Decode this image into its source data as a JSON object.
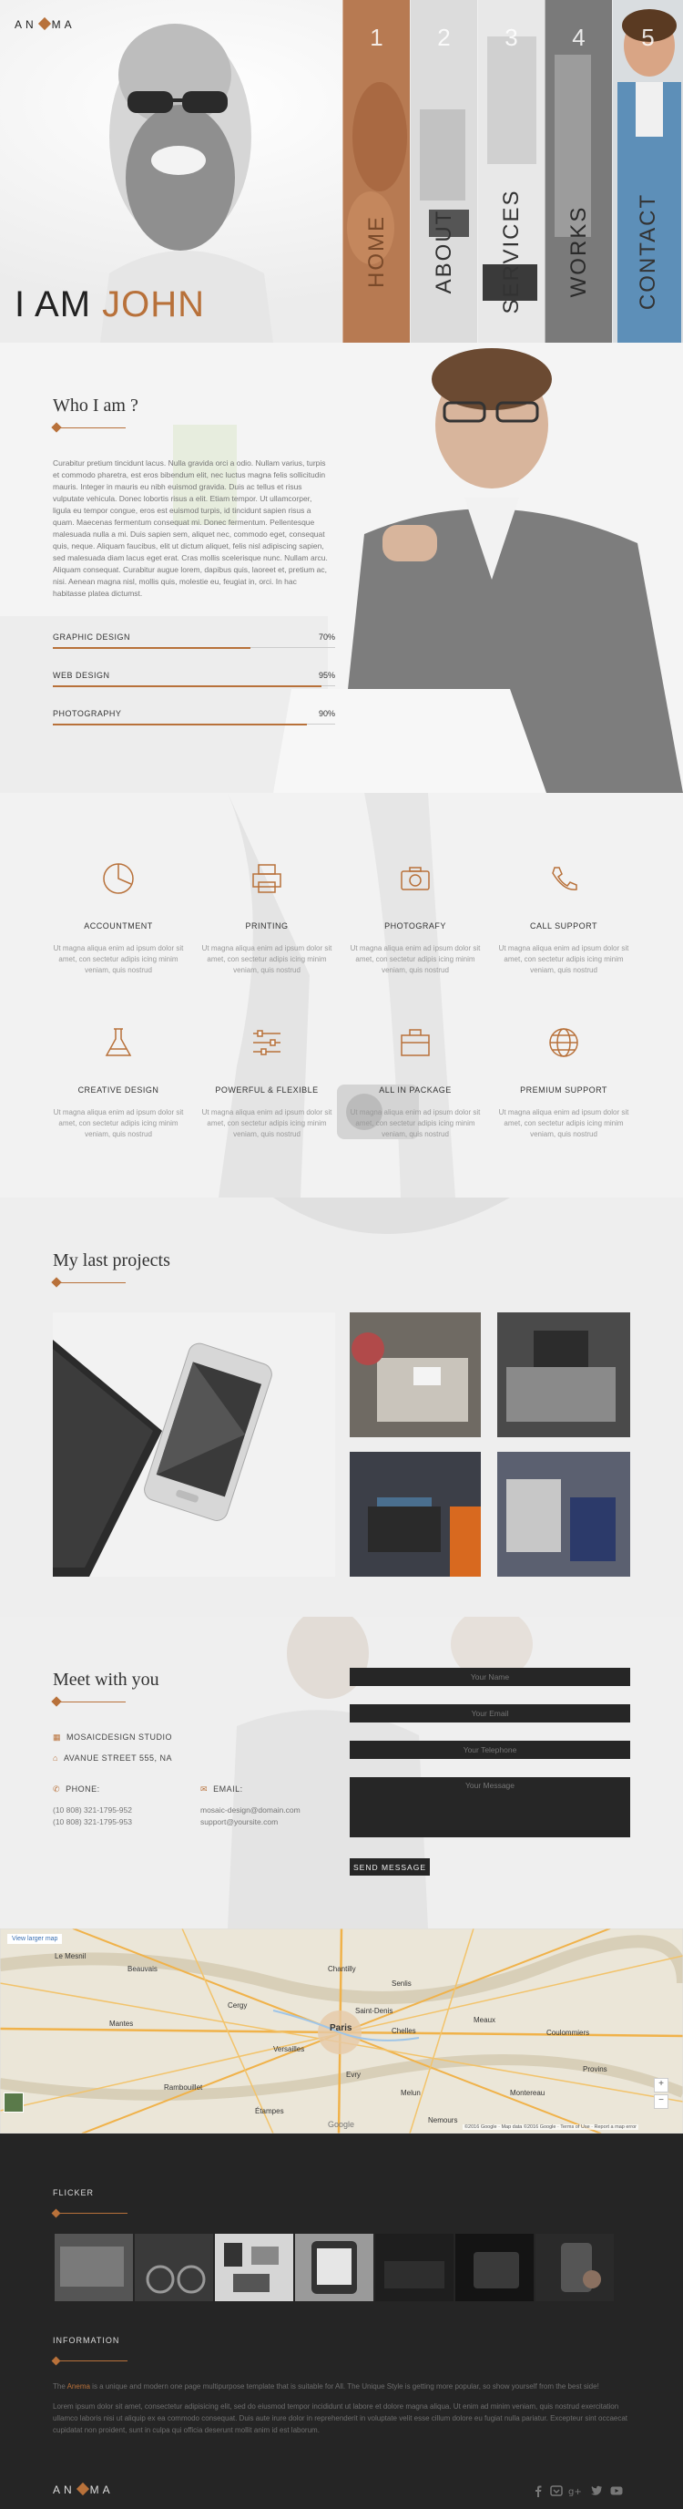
{
  "brand": {
    "logo_text_left": "AN",
    "logo_text_right": "MA",
    "accent": "#b8713a"
  },
  "hero": {
    "title_prefix": "I AM",
    "title_name": "JOHN",
    "panels": [
      {
        "num": "1",
        "label": "HOME"
      },
      {
        "num": "2",
        "label": "ABOUT"
      },
      {
        "num": "3",
        "label": "SERVICES"
      },
      {
        "num": "4",
        "label": "WORKS"
      },
      {
        "num": "5",
        "label": "CONTACT"
      }
    ]
  },
  "about": {
    "title": "Who I am ?",
    "text": "Curabitur pretium tincidunt lacus. Nulla gravida orci a odio. Nullam varius, turpis et commodo pharetra, est eros bibendum elit, nec luctus magna felis sollicitudin mauris. Integer in mauris eu nibh euismod gravida. Duis ac tellus et risus vulputate vehicula. Donec lobortis risus a elit. Etiam tempor. Ut ullamcorper, ligula eu tempor congue, eros est euismod turpis, id tincidunt sapien risus a quam. Maecenas fermentum consequat mi. Donec fermentum. Pellentesque malesuada nulla a mi. Duis sapien sem, aliquet nec, commodo eget, consequat quis, neque. Aliquam faucibus, elit ut dictum aliquet, felis nisl adipiscing sapien, sed malesuada diam lacus eget erat. Cras mollis scelerisque nunc. Nullam arcu. Aliquam consequat. Curabitur augue lorem, dapibus quis, laoreet et, pretium ac, nisi. Aenean magna nisl, mollis quis, molestie eu, feugiat in, orci. In hac habitasse platea dictumst.",
    "skills": [
      {
        "name": "GRAPHIC DESIGN",
        "pct_label": "70%",
        "value": 0.7
      },
      {
        "name": "WEB DESIGN",
        "pct_label": "95%",
        "value": 0.95
      },
      {
        "name": "PHOTOGRAPHY",
        "pct_label": "90%",
        "value": 0.9
      }
    ]
  },
  "services": {
    "items": [
      {
        "icon": "pie-chart-icon",
        "title": "ACCOUNTMENT",
        "desc": "Ut magna aliqua enim ad ipsum dolor sit amet, con sectetur adipis icing minim veniam, quis nostrud"
      },
      {
        "icon": "printer-icon",
        "title": "PRINTING",
        "desc": "Ut magna aliqua enim ad ipsum dolor sit amet, con sectetur adipis icing minim veniam, quis nostrud"
      },
      {
        "icon": "camera-icon",
        "title": "PHOTOGRAFY",
        "desc": "Ut magna aliqua enim ad ipsum dolor sit amet, con sectetur adipis icing minim veniam, quis nostrud"
      },
      {
        "icon": "phone-icon",
        "title": "CALL SUPPORT",
        "desc": "Ut magna aliqua enim ad ipsum dolor sit amet, con sectetur adipis icing minim veniam, quis nostrud"
      },
      {
        "icon": "flask-icon",
        "title": "CREATIVE DESIGN",
        "desc": "Ut magna aliqua enim ad ipsum dolor sit amet, con sectetur adipis icing minim veniam, quis nostrud"
      },
      {
        "icon": "sliders-icon",
        "title": "POWERFUL & FLEXIBLE",
        "desc": "Ut magna aliqua enim ad ipsum dolor sit amet, con sectetur adipis icing minim veniam, quis nostrud"
      },
      {
        "icon": "package-icon",
        "title": "ALL IN PACKAGE",
        "desc": "Ut magna aliqua enim ad ipsum dolor sit amet, con sectetur adipis icing minim veniam, quis nostrud"
      },
      {
        "icon": "globe-icon",
        "title": "PREMIUM SUPPORT",
        "desc": "Ut magna aliqua enim ad ipsum dolor sit amet, con sectetur adipis icing minim veniam, quis nostrud"
      }
    ]
  },
  "projects": {
    "title": "My last projects"
  },
  "contact": {
    "title": "Meet with you",
    "company": "MOSAICDESIGN STUDIO",
    "address": "AVANUE STREET 555, NA",
    "phone_label": "PHONE:",
    "phones": [
      "(10 808) 321-1795-952",
      "(10 808) 321-1795-953"
    ],
    "email_label": "EMAIL:",
    "emails": [
      "mosaic-design@domain.com",
      "support@yoursite.com"
    ],
    "placeholders": {
      "name": "Your Name",
      "email": "Your Email",
      "telephone": "Your Telephone",
      "message": "Your Message"
    },
    "send_label": "SEND MESSAGE"
  },
  "map": {
    "view_larger": "View larger map",
    "center_city": "Paris",
    "cities": [
      "Le Mesnil",
      "Beauvais",
      "Chantilly",
      "Meaux",
      "Versailles",
      "Melun",
      "Saint-Denis",
      "Chelles",
      "Cergy",
      "Evry",
      "Rambouillet",
      "Nemours",
      "Mantes",
      "Provins",
      "Coulommiers",
      "Montereau",
      "Étampes",
      "Senlis"
    ],
    "attribution": "©2016 Google · Map data ©2016 Google · Terms of Use · Report a map error",
    "google": "Google"
  },
  "footer": {
    "flickr_title": "FLICKER",
    "info_title": "INFORMATION",
    "info_lead": "The",
    "info_brand": "Anema",
    "info_text_1": "is a unique and modern one page multipurpose template that is suitable for All. The Unique Style is getting more popular, so show yourself from the best side!",
    "info_text_2": "Lorem ipsum dolor sit amet, consectetur adipisicing elit, sed do eiusmod tempor incididunt ut labore et dolore magna aliqua. Ut enim ad minim veniam, quis nostrud exercitation ullamco laboris nisi ut aliquip ex ea commodo consequat. Duis aute irure dolor in reprehenderit in voluptate velit esse cillum dolore eu fugiat nulla pariatur. Excepteur sint occaecat cupidatat non proident, sunt in culpa qui officia deserunt mollit anim id est laborum.",
    "social": [
      "facebook-icon",
      "pinterest-icon",
      "google-plus-icon",
      "twitter-icon",
      "youtube-icon"
    ]
  }
}
